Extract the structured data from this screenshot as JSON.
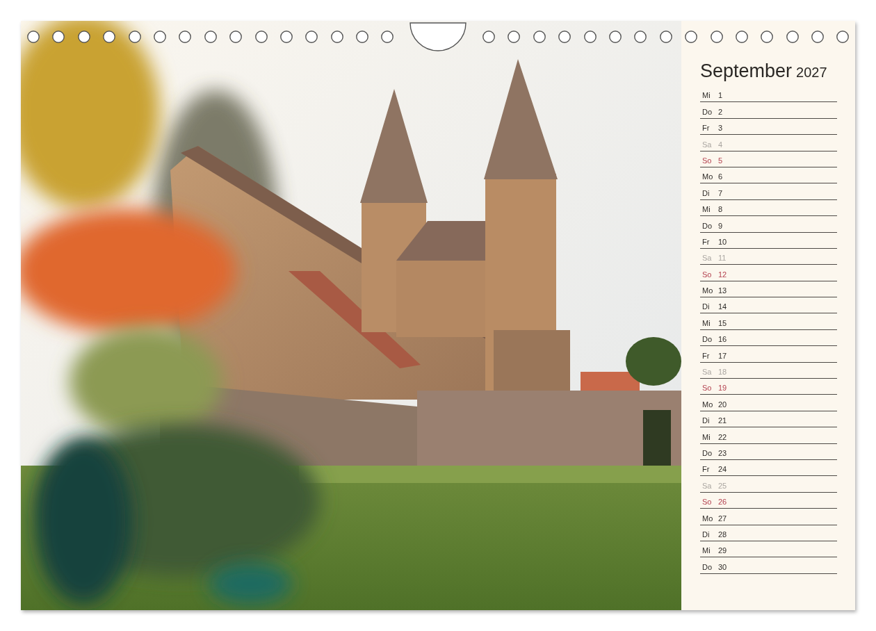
{
  "calendar_page": {
    "photo": {
      "kind": "photo"
    },
    "month": "September",
    "year": "2027",
    "days": [
      {
        "weekday": "Mi",
        "day": "1",
        "kind": "weekday"
      },
      {
        "weekday": "Do",
        "day": "2",
        "kind": "weekday"
      },
      {
        "weekday": "Fr",
        "day": "3",
        "kind": "weekday"
      },
      {
        "weekday": "Sa",
        "day": "4",
        "kind": "saturday"
      },
      {
        "weekday": "So",
        "day": "5",
        "kind": "sunday"
      },
      {
        "weekday": "Mo",
        "day": "6",
        "kind": "weekday"
      },
      {
        "weekday": "Di",
        "day": "7",
        "kind": "weekday"
      },
      {
        "weekday": "Mi",
        "day": "8",
        "kind": "weekday"
      },
      {
        "weekday": "Do",
        "day": "9",
        "kind": "weekday"
      },
      {
        "weekday": "Fr",
        "day": "10",
        "kind": "weekday"
      },
      {
        "weekday": "Sa",
        "day": "11",
        "kind": "saturday"
      },
      {
        "weekday": "So",
        "day": "12",
        "kind": "sunday"
      },
      {
        "weekday": "Mo",
        "day": "13",
        "kind": "weekday"
      },
      {
        "weekday": "Di",
        "day": "14",
        "kind": "weekday"
      },
      {
        "weekday": "Mi",
        "day": "15",
        "kind": "weekday"
      },
      {
        "weekday": "Do",
        "day": "16",
        "kind": "weekday"
      },
      {
        "weekday": "Fr",
        "day": "17",
        "kind": "weekday"
      },
      {
        "weekday": "Sa",
        "day": "18",
        "kind": "saturday"
      },
      {
        "weekday": "So",
        "day": "19",
        "kind": "sunday"
      },
      {
        "weekday": "Mo",
        "day": "20",
        "kind": "weekday"
      },
      {
        "weekday": "Di",
        "day": "21",
        "kind": "weekday"
      },
      {
        "weekday": "Mi",
        "day": "22",
        "kind": "weekday"
      },
      {
        "weekday": "Do",
        "day": "23",
        "kind": "weekday"
      },
      {
        "weekday": "Fr",
        "day": "24",
        "kind": "weekday"
      },
      {
        "weekday": "Sa",
        "day": "25",
        "kind": "saturday"
      },
      {
        "weekday": "So",
        "day": "26",
        "kind": "sunday"
      },
      {
        "weekday": "Mo",
        "day": "27",
        "kind": "weekday"
      },
      {
        "weekday": "Di",
        "day": "28",
        "kind": "weekday"
      },
      {
        "weekday": "Mi",
        "day": "29",
        "kind": "weekday"
      },
      {
        "weekday": "Do",
        "day": "30",
        "kind": "weekday"
      }
    ]
  }
}
